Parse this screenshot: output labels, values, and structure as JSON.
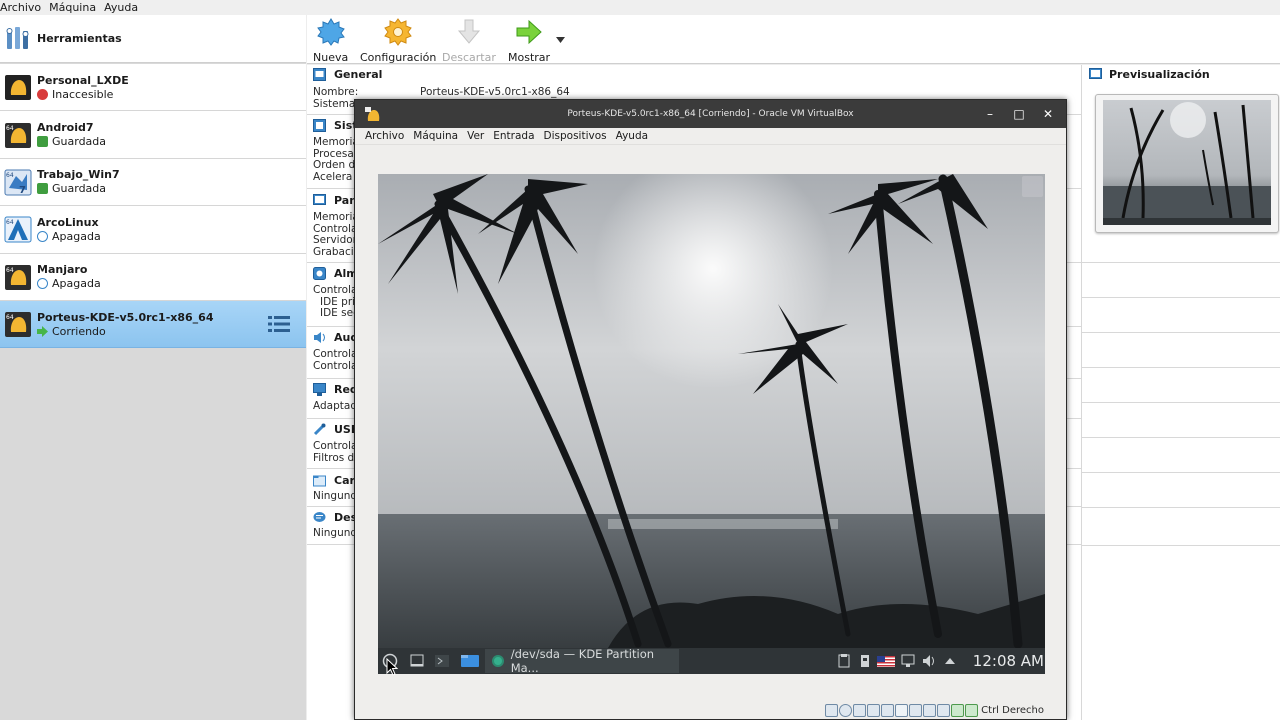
{
  "menu": [
    "Archivo",
    "Máquina",
    "Ayuda"
  ],
  "tools": {
    "label": "Herramientas"
  },
  "vms": [
    {
      "name": "Personal_LXDE",
      "state": "Inaccesible",
      "state_color": "#d83b3b"
    },
    {
      "name": "Android7",
      "state": "Guardada",
      "state_color": "#3f9d3f"
    },
    {
      "name": "Trabajo_Win7",
      "state": "Guardada",
      "state_color": "#3f9d3f"
    },
    {
      "name": "ArcoLinux",
      "state": "Apagada",
      "state_color": "#3a86c8"
    },
    {
      "name": "Manjaro",
      "state": "Apagada",
      "state_color": "#3a86c8"
    },
    {
      "name": "Porteus-KDE-v5.0rc1-x86_64",
      "state": "Corriendo",
      "state_color": "#47b548",
      "selected": true
    }
  ],
  "toolbar": {
    "new": "Nueva",
    "settings": "Configuración",
    "discard": "Descartar",
    "show": "Mostrar"
  },
  "details": {
    "general": {
      "title": "General",
      "name_label": "Nombre:",
      "name_value": "Porteus-KDE-v5.0rc1-x86_64",
      "system_label": "Sistema"
    },
    "system": {
      "title": "Sist",
      "rows": [
        "Memoria",
        "Procesa",
        "Orden d",
        "Acelera"
      ]
    },
    "display": {
      "title": "Pan",
      "rows": [
        "Memoria",
        "Controla",
        "Servidor",
        "Grabaci"
      ]
    },
    "storage": {
      "title": "Alm",
      "rows": [
        "Controla",
        "  IDE pri",
        "  IDE sec"
      ]
    },
    "audio": {
      "title": "Aud",
      "rows": [
        "Controla",
        "Controla"
      ]
    },
    "network": {
      "title": "Red",
      "rows": [
        "Adaptad"
      ]
    },
    "usb": {
      "title": "USB",
      "rows": [
        "Controla",
        "Filtros d"
      ]
    },
    "shared": {
      "title": "Car",
      "rows": [
        "Ningund"
      ]
    },
    "description": {
      "title": "Des",
      "rows": [
        "Ningund"
      ]
    }
  },
  "preview": {
    "title": "Previsualización"
  },
  "vm_window": {
    "title": "Porteus-KDE-v5.0rc1-x86_64 [Corriendo] - Oracle VM VirtualBox",
    "menu": [
      "Archivo",
      "Máquina",
      "Ver",
      "Entrada",
      "Dispositivos",
      "Ayuda"
    ],
    "taskbar_item": "/dev/sda — KDE Partition Ma...",
    "clock": "12:08 AM",
    "host_key": "Ctrl Derecho"
  },
  "colors": {
    "selection": "#9dcdf3",
    "accent": "#3a86c8"
  }
}
